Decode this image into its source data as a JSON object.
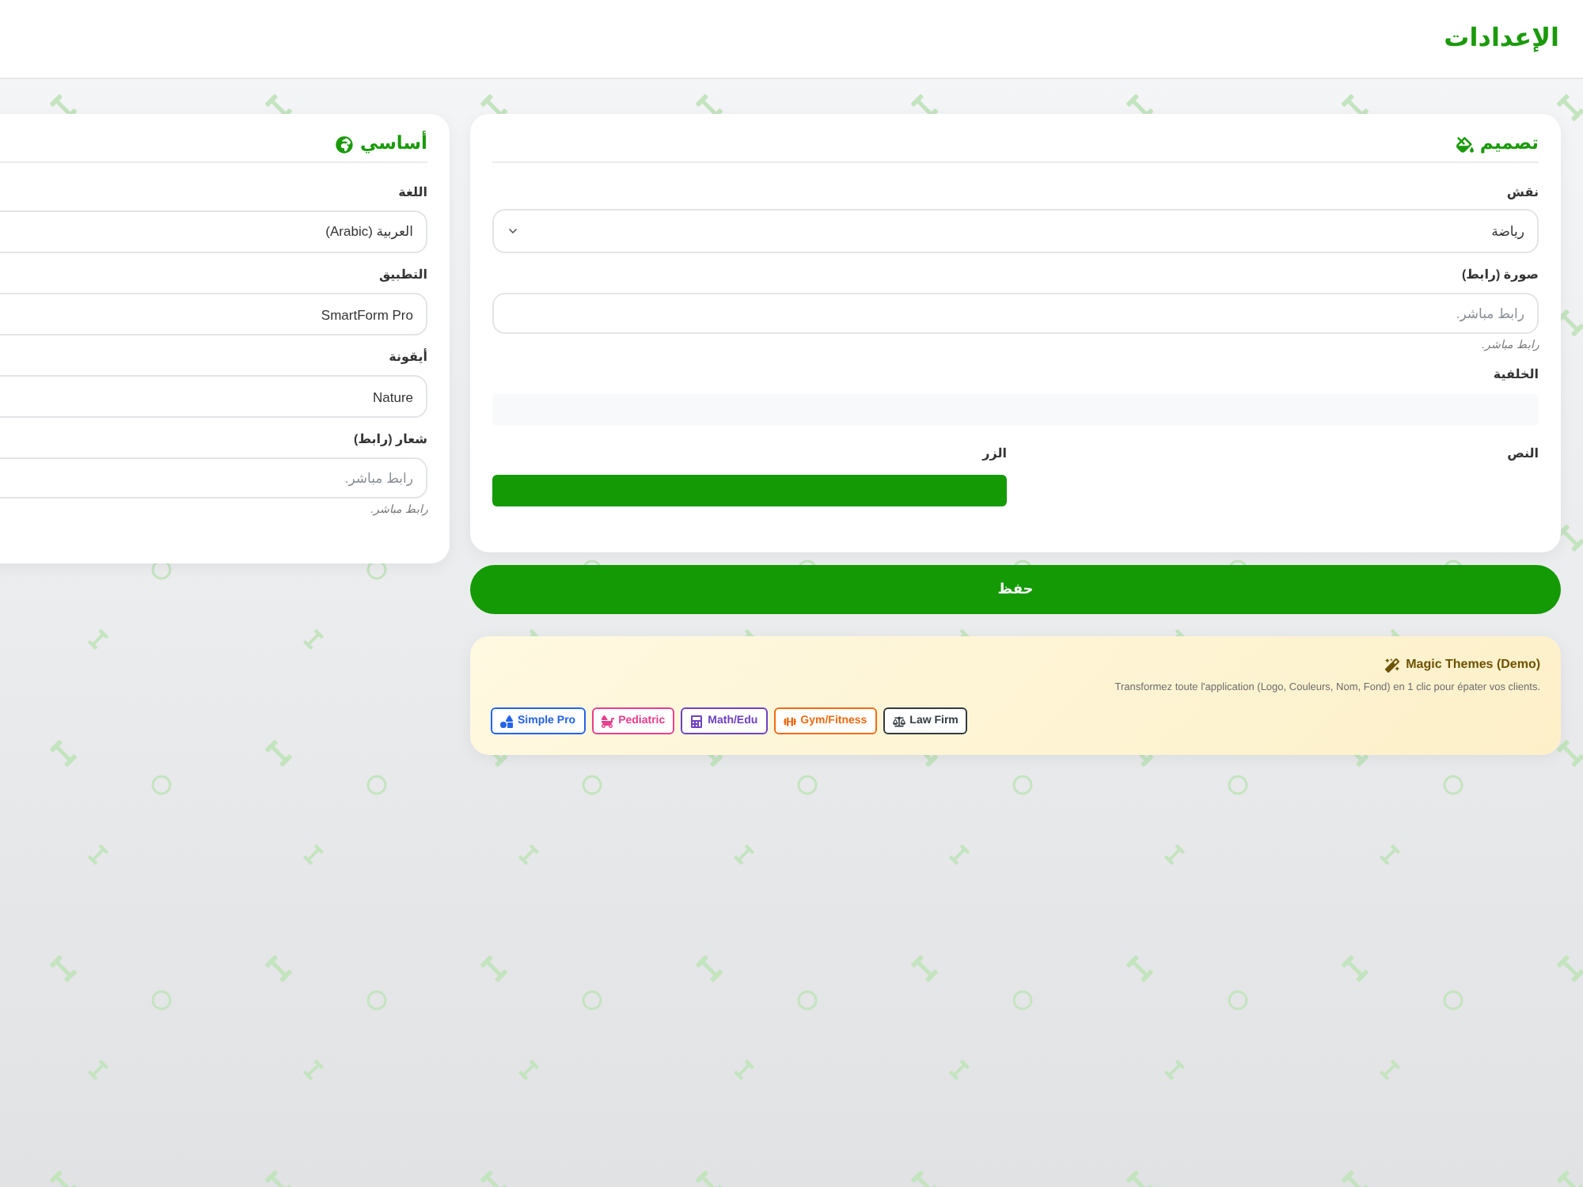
{
  "header": {
    "title": "الإعدادات"
  },
  "design_card": {
    "title": "تصميم",
    "fields": [
      {
        "kind": "select",
        "label": "نقش",
        "value": "رياضة"
      },
      {
        "kind": "url",
        "label": "صورة (رابط)",
        "placeholder": "رابط مباشر.",
        "hint": "رابط مباشر."
      },
      {
        "kind": "color",
        "label": "الخلفية",
        "color": "#f8f9fa"
      }
    ],
    "color_pair": [
      {
        "label": "النص"
      },
      {
        "label": "الزر",
        "color": "#149a04"
      }
    ]
  },
  "basic_card": {
    "title": "أساسي",
    "fields": [
      {
        "kind": "input",
        "label": "اللغة",
        "value": "العربية (Arabic)"
      },
      {
        "kind": "input",
        "label": "التطبيق",
        "value": "SmartForm Pro"
      },
      {
        "kind": "input",
        "label": "أيقونة",
        "value": "Nature"
      },
      {
        "kind": "url",
        "label": "شعار (رابط)",
        "placeholder": "رابط مباشر.",
        "hint": "رابط مباشر."
      }
    ]
  },
  "save_button": {
    "label": "حفظ"
  },
  "magic_themes": {
    "title": "Magic Themes (Demo)",
    "description": "Transformez toute l'application (Logo, Couleurs, Nom, Fond) en 1 clic pour épater vos clients.",
    "presets": [
      {
        "label": "Law Firm",
        "color": "#343a40"
      },
      {
        "label": "Gym/Fitness",
        "color": "#f26b12"
      },
      {
        "label": "Math/Edu",
        "color": "#6f42c1"
      },
      {
        "label": "Pediatric",
        "color": "#e83e8c"
      },
      {
        "label": "Simple Pro",
        "color": "#2563eb"
      }
    ]
  }
}
